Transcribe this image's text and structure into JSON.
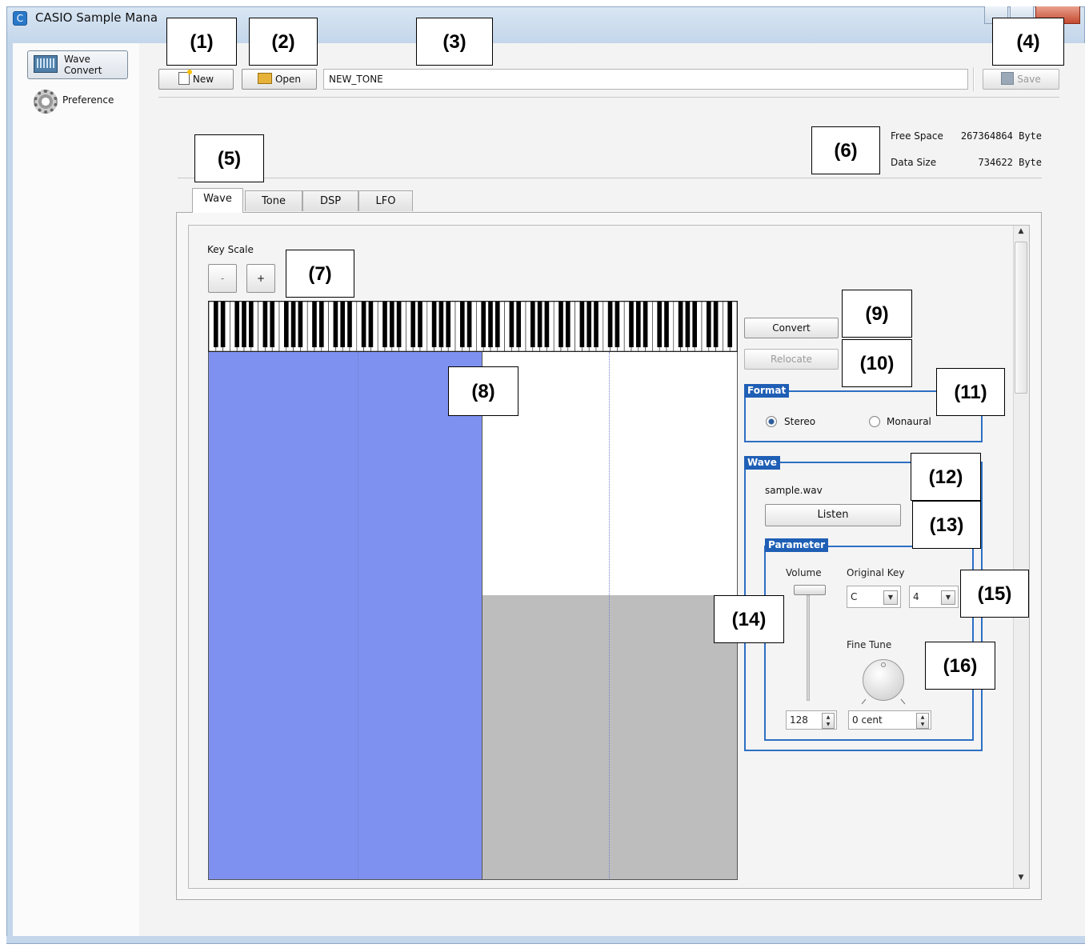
{
  "window": {
    "title": "CASIO Sample Mana"
  },
  "sidebar": {
    "items": [
      {
        "label": "Wave\nConvert",
        "icon": "wave-convert-icon"
      },
      {
        "label": "Preference",
        "icon": "gear-icon"
      }
    ]
  },
  "toolbar": {
    "new_label": "New",
    "open_label": "Open",
    "name_value": "NEW_TONE",
    "save_label": "Save"
  },
  "info": {
    "free_space_label": "Free Space",
    "free_space_value": "267364864 Byte",
    "data_size_label": "Data Size",
    "data_size_value": "734622 Byte"
  },
  "tabs": [
    {
      "label": "Wave",
      "active": true
    },
    {
      "label": "Tone",
      "active": false
    },
    {
      "label": "DSP",
      "active": false
    },
    {
      "label": "LFO",
      "active": false
    }
  ],
  "wave_tab": {
    "key_scale_label": "Key Scale",
    "key_scale_minus": "-",
    "key_scale_plus": "+",
    "convert_label": "Convert",
    "relocate_label": "Relocate",
    "format": {
      "title": "Format",
      "options": [
        "Stereo",
        "Monaural"
      ],
      "selected": "Stereo"
    },
    "wave": {
      "title": "Wave",
      "filename": "sample.wav",
      "listen_label": "Listen",
      "parameter": {
        "title": "Parameter",
        "volume_label": "Volume",
        "volume_value": "128",
        "original_key_label": "Original Key",
        "original_key_note": "C",
        "original_key_octave": "4",
        "fine_tune_label": "Fine Tune",
        "fine_tune_value": "0 cent"
      }
    }
  },
  "callouts": [
    "(1)",
    "(2)",
    "(3)",
    "(4)",
    "(5)",
    "(6)",
    "(7)",
    "(8)",
    "(9)",
    "(10)",
    "(11)",
    "(12)",
    "(13)",
    "(14)",
    "(15)",
    "(16)"
  ],
  "colors": {
    "accent": "#1f5fb5",
    "zone_blue": "#7f91f0",
    "zone_gray": "#bdbdbd"
  }
}
